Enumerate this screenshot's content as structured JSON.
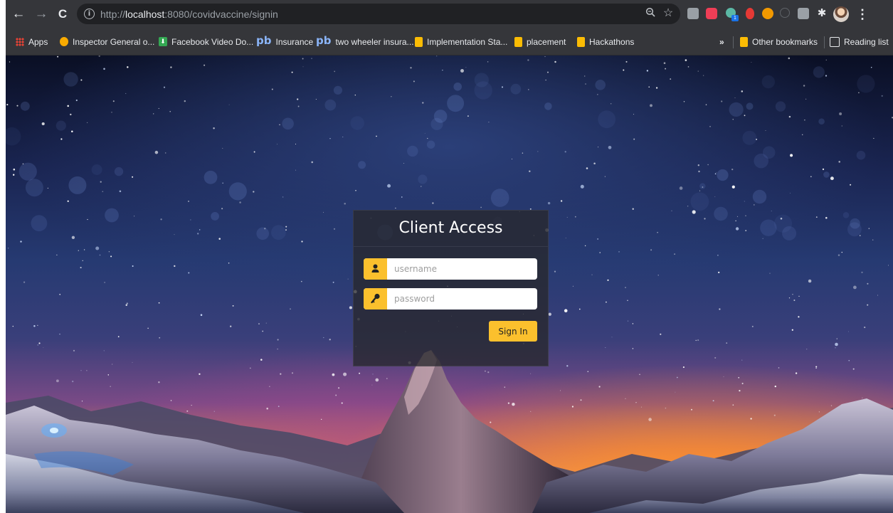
{
  "browser": {
    "url_scheme": "http://",
    "url_host": "localhost",
    "url_rest": ":8080/covidvaccine/signin"
  },
  "bookmarks": {
    "items": [
      {
        "label": "Apps",
        "icon": "apps-grid-icon"
      },
      {
        "label": "Inspector General o...",
        "icon": "globe-icon"
      },
      {
        "label": "Facebook Video Do...",
        "icon": "download-icon"
      },
      {
        "label": "Insurance",
        "icon": "pb-icon"
      },
      {
        "label": "two wheeler insura...",
        "icon": "pb-icon"
      },
      {
        "label": "Implementation Sta...",
        "icon": "folder-icon"
      },
      {
        "label": "placement",
        "icon": "folder-icon"
      },
      {
        "label": "Hackathons",
        "icon": "folder-icon"
      }
    ],
    "overflow": "»",
    "other": "Other bookmarks",
    "reading_list": "Reading list"
  },
  "login": {
    "title": "Client Access",
    "username_placeholder": "username",
    "password_placeholder": "password",
    "signin_label": "Sign In",
    "accent_color": "#fbc02d"
  }
}
